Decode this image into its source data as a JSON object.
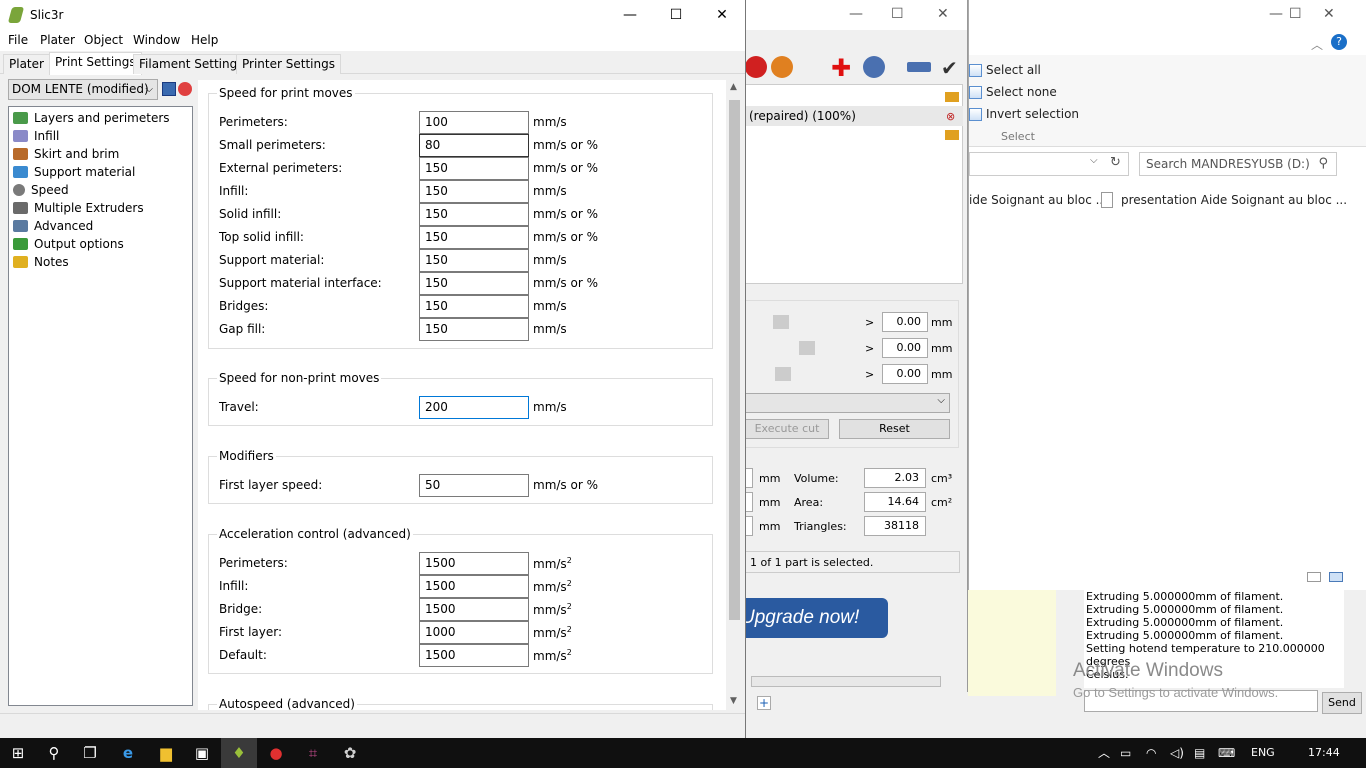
{
  "explorer": {
    "select_all": "Select all",
    "select_none": "Select none",
    "invert_selection": "Invert selection",
    "select_group": "Select",
    "search_placeholder": "Search MANDRESYUSB (D:)",
    "file1": "ide Soignant au bloc ...",
    "file2": "presentation Aide Soignant au bloc ..."
  },
  "plater": {
    "object_row": "(repaired) (100%)",
    "rot_x": "0.00",
    "rot_y": "0.00",
    "rot_z": "0.00",
    "unit_mm": "mm",
    "execute_cut": "Execute cut",
    "reset": "Reset",
    "volume_label": "Volume:",
    "volume_value": "2.03",
    "area_label": "Area:",
    "area_value": "14.64",
    "triangles_label": "Triangles:",
    "triangles_value": "38118",
    "unit_cm3": "cm³",
    "unit_cm2": "cm²",
    "selection_status": "1 of 1 part is selected.",
    "upgrade": "Upgrade now!"
  },
  "log": {
    "lines": [
      "Extruding 5.000000mm of filament.",
      "Extruding 5.000000mm of filament.",
      "Extruding 5.000000mm of filament.",
      "Extruding 5.000000mm of filament.",
      "Setting hotend temperature to 210.000000 degrees",
      "Celsius."
    ],
    "send": "Send",
    "watermark_title": "Activate Windows",
    "watermark_sub": "Go to Settings to activate Windows."
  },
  "window": {
    "title": "Slic3r",
    "minimize": "—",
    "maximize": "☐",
    "close": "✕"
  },
  "menu": [
    "File",
    "Plater",
    "Object",
    "Window",
    "Help"
  ],
  "tabs": [
    "Plater",
    "Print Settings",
    "Filament Settings",
    "Printer Settings"
  ],
  "preset": "DOM LENTE (modified)",
  "nav": [
    {
      "label": "Layers and perimeters",
      "color": "#4a9a4a"
    },
    {
      "label": "Infill",
      "color": "#8a8ac8"
    },
    {
      "label": "Skirt and brim",
      "color": "#b86a2a"
    },
    {
      "label": "Support material",
      "color": "#3a8ad0"
    },
    {
      "label": "Speed",
      "color": "#7a7a7a"
    },
    {
      "label": "Multiple Extruders",
      "color": "#6a6a6a"
    },
    {
      "label": "Advanced",
      "color": "#5a7aa0"
    },
    {
      "label": "Output options",
      "color": "#3a9a3a"
    },
    {
      "label": "Notes",
      "color": "#e0b020"
    }
  ],
  "groups": {
    "print_moves": {
      "title": "Speed for print moves",
      "rows": [
        {
          "label": "Perimeters:",
          "value": "100",
          "unit": "mm/s"
        },
        {
          "label": "Small perimeters:",
          "value": "80",
          "unit": "mm/s or %"
        },
        {
          "label": "External perimeters:",
          "value": "150",
          "unit": "mm/s or %"
        },
        {
          "label": "Infill:",
          "value": "150",
          "unit": "mm/s"
        },
        {
          "label": "Solid infill:",
          "value": "150",
          "unit": "mm/s or %"
        },
        {
          "label": "Top solid infill:",
          "value": "150",
          "unit": "mm/s or %"
        },
        {
          "label": "Support material:",
          "value": "150",
          "unit": "mm/s"
        },
        {
          "label": "Support material interface:",
          "value": "150",
          "unit": "mm/s or %"
        },
        {
          "label": "Bridges:",
          "value": "150",
          "unit": "mm/s"
        },
        {
          "label": "Gap fill:",
          "value": "150",
          "unit": "mm/s"
        }
      ]
    },
    "non_print": {
      "title": "Speed for non-print moves",
      "rows": [
        {
          "label": "Travel:",
          "value": "200",
          "unit": "mm/s"
        }
      ]
    },
    "modifiers": {
      "title": "Modifiers",
      "rows": [
        {
          "label": "First layer speed:",
          "value": "50",
          "unit": "mm/s or %"
        }
      ]
    },
    "acceleration": {
      "title": "Acceleration control (advanced)",
      "unit_base": "mm/s",
      "unit_sup": "2",
      "rows": [
        {
          "label": "Perimeters:",
          "value": "1500"
        },
        {
          "label": "Infill:",
          "value": "1500"
        },
        {
          "label": "Bridge:",
          "value": "1500"
        },
        {
          "label": "First layer:",
          "value": "1000"
        },
        {
          "label": "Default:",
          "value": "1500"
        }
      ]
    },
    "autospeed": {
      "title": "Autospeed (advanced)"
    }
  },
  "taskbar": {
    "lang": "ENG",
    "time": "17:44"
  }
}
